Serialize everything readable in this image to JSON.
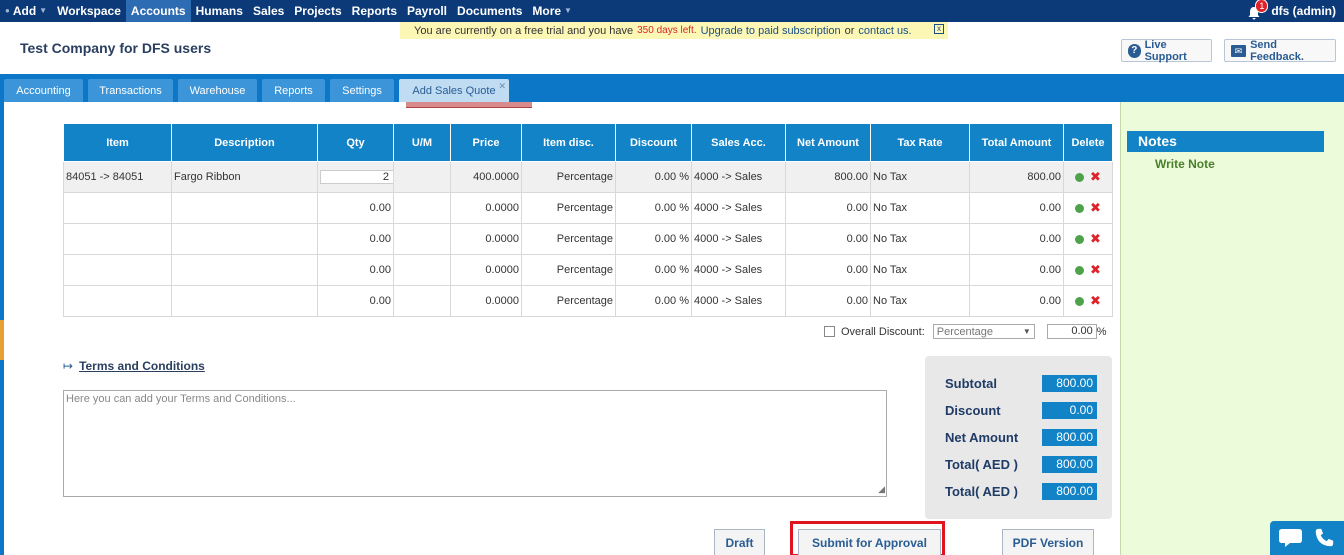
{
  "topnav": {
    "items": [
      {
        "label": "Add",
        "caret": true
      },
      {
        "label": "Workspace"
      },
      {
        "label": "Accounts",
        "active": true
      },
      {
        "label": "Humans"
      },
      {
        "label": "Sales"
      },
      {
        "label": "Projects"
      },
      {
        "label": "Reports"
      },
      {
        "label": "Payroll"
      },
      {
        "label": "Documents"
      },
      {
        "label": "More",
        "caret": true
      }
    ],
    "notification_count": "1",
    "user": "dfs (admin)"
  },
  "banner": {
    "before": "You are currently on a free trial and you have",
    "days": "350 days left.",
    "upgrade": "Upgrade to paid subscription",
    "or": "or",
    "contact": "contact us.",
    "close": "x"
  },
  "company": "Test Company for DFS users",
  "live_support": "Live Support",
  "send_feedback": "Send Feedback.",
  "tabs": [
    "Accounting",
    "Transactions",
    "Warehouse",
    "Reports",
    "Settings",
    "Add Sales Quote"
  ],
  "table": {
    "headers": [
      "Item",
      "Description",
      "Qty",
      "U/M",
      "Price",
      "Item disc.",
      "Discount",
      "Sales Acc.",
      "Net Amount",
      "Tax Rate",
      "Total Amount",
      "Delete"
    ],
    "rows": [
      {
        "item": "84051 -> 84051",
        "desc": "Fargo Ribbon",
        "qty": "2",
        "um": "",
        "price": "400.0000",
        "item_disc": "Percentage",
        "discount": "0.00 %",
        "sales_acc": "4000 -> Sales",
        "net": "800.00",
        "tax": "No Tax",
        "total": "800.00"
      },
      {
        "item": "",
        "desc": "",
        "qty": "0.00",
        "um": "",
        "price": "0.0000",
        "item_disc": "Percentage",
        "discount": "0.00 %",
        "sales_acc": "4000 -> Sales",
        "net": "0.00",
        "tax": "No Tax",
        "total": "0.00"
      },
      {
        "item": "",
        "desc": "",
        "qty": "0.00",
        "um": "",
        "price": "0.0000",
        "item_disc": "Percentage",
        "discount": "0.00 %",
        "sales_acc": "4000 -> Sales",
        "net": "0.00",
        "tax": "No Tax",
        "total": "0.00"
      },
      {
        "item": "",
        "desc": "",
        "qty": "0.00",
        "um": "",
        "price": "0.0000",
        "item_disc": "Percentage",
        "discount": "0.00 %",
        "sales_acc": "4000 -> Sales",
        "net": "0.00",
        "tax": "No Tax",
        "total": "0.00"
      },
      {
        "item": "",
        "desc": "",
        "qty": "0.00",
        "um": "",
        "price": "0.0000",
        "item_disc": "Percentage",
        "discount": "0.00 %",
        "sales_acc": "4000 -> Sales",
        "net": "0.00",
        "tax": "No Tax",
        "total": "0.00"
      }
    ]
  },
  "overall_discount": {
    "label": "Overall Discount:",
    "type": "Percentage",
    "value": "0.00",
    "unit": "%"
  },
  "terms": {
    "title": "Terms and Conditions",
    "placeholder": "Here you can add your Terms and Conditions..."
  },
  "totals": [
    {
      "label": "Subtotal",
      "value": "800.00"
    },
    {
      "label": "Discount",
      "value": "0.00"
    },
    {
      "label": "Net Amount",
      "value": "800.00"
    },
    {
      "label": "Total( AED )",
      "value": "800.00"
    },
    {
      "label": "Total( AED )",
      "value": "800.00"
    }
  ],
  "buttons": {
    "draft": "Draft",
    "submit": "Submit for Approval",
    "pdf": "PDF Version"
  },
  "notes": {
    "title": "Notes",
    "write": "Write Note"
  },
  "colors": {
    "nav": "#0c3a78",
    "accent": "#1283c7",
    "highlight": "#e0141e"
  }
}
